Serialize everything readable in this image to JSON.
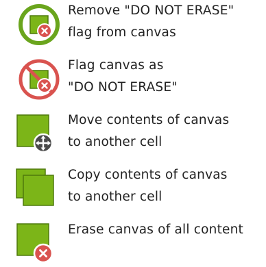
{
  "menu": {
    "items": [
      {
        "label": "Remove \"DO NOT ERASE\"\nflag from canvas",
        "icon": "canvas-unprotect-icon"
      },
      {
        "label": "Flag canvas as\n\"DO NOT ERASE\"",
        "icon": "canvas-no-erase-icon"
      },
      {
        "label": "Move contents of canvas\nto another cell",
        "icon": "canvas-move-icon"
      },
      {
        "label": "Copy contents of canvas\nto another cell",
        "icon": "canvas-copy-icon"
      },
      {
        "label": "Erase canvas of all content",
        "icon": "canvas-erase-icon"
      }
    ]
  },
  "colors": {
    "canvas_green": "#7cb518",
    "canvas_border": "#4e7a0c",
    "ring_green": "#6aa51d",
    "ring_red": "#d9534f",
    "badge_red": "#d9534f",
    "badge_dark": "#4a4a4a"
  }
}
